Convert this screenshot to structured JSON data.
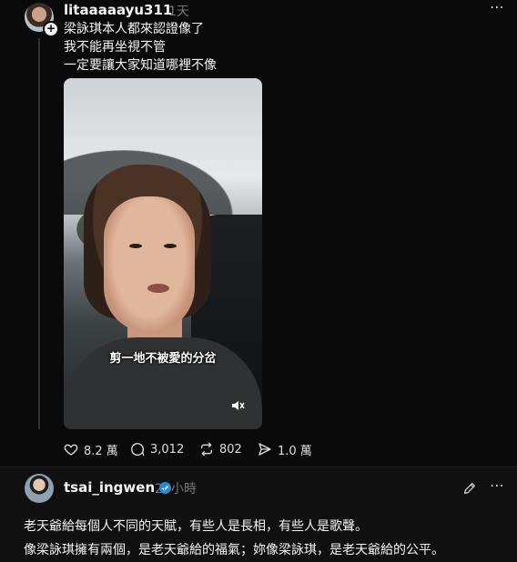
{
  "post1": {
    "username": "litaaaaayu311",
    "time": "1天",
    "more_icon": "⋯",
    "lines": [
      "梁詠琪本人都來認證像了",
      "我不能再坐視不管",
      "一定要讓大家知道哪裡不像"
    ],
    "video_caption": "剪一地不被愛的分岔",
    "stats": {
      "likes": "8.2 萬",
      "comments": "3,012",
      "reposts": "802",
      "shares": "1.0 萬"
    }
  },
  "post2": {
    "username": "tsai_ingwen",
    "time": "20小時",
    "more_icon": "⋯",
    "lines": [
      "老天爺給每個人不同的天賦，有些人是長相，有些人是歌聲。",
      "像梁詠琪擁有兩個，是老天爺給的福氣；妳像梁詠琪，是老天爺給的公平。"
    ]
  },
  "colors": {
    "background": "#0a0a0a",
    "text": "#f3f5f7",
    "muted": "#777777",
    "verified": "#0095f6"
  },
  "icons": [
    "heart-icon",
    "comment-icon",
    "repost-icon",
    "share-icon",
    "mute-icon",
    "edit-icon",
    "more-icon",
    "verified-icon",
    "follow-plus-icon"
  ]
}
